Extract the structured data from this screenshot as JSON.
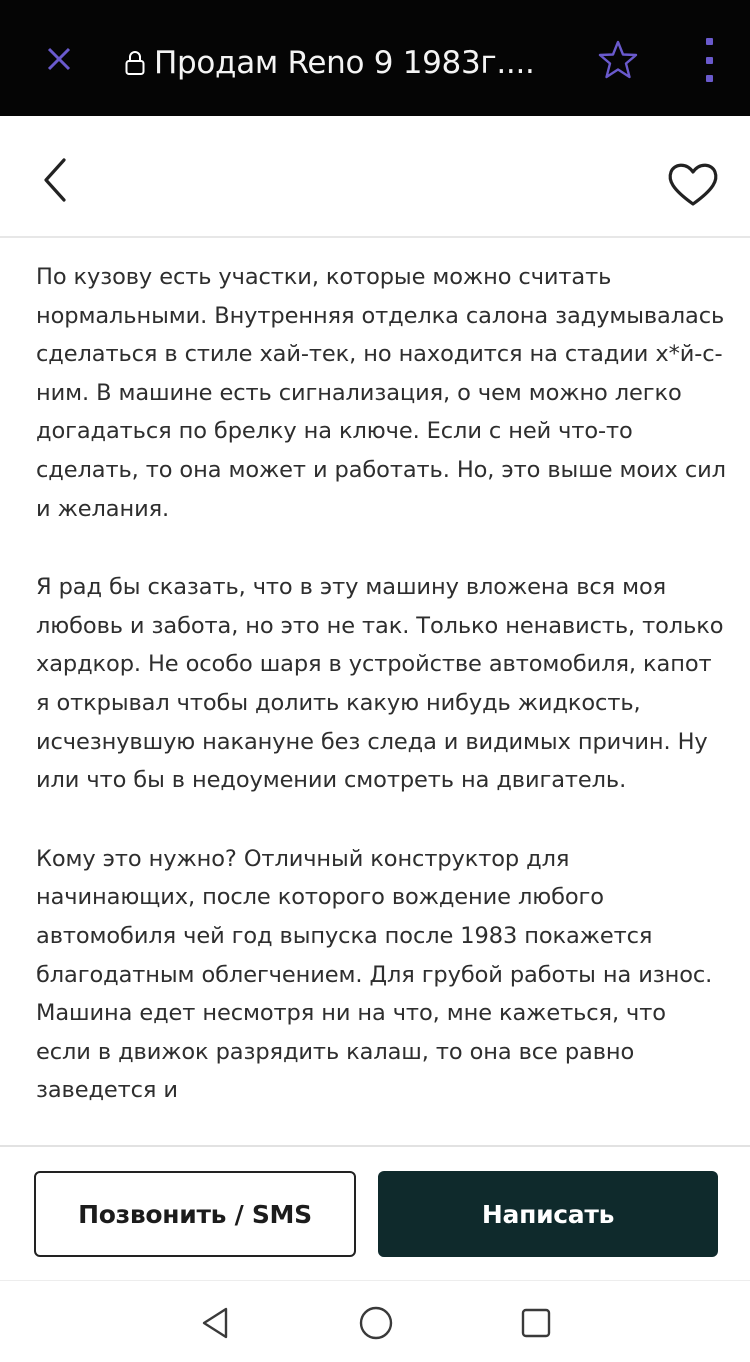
{
  "browser": {
    "title": "Продам Reno 9 1983г....",
    "icons": {
      "close": "close-icon",
      "lock": "lock-icon",
      "star": "star-icon",
      "menu": "more-vertical-icon"
    },
    "colors": {
      "bar": "#050505",
      "close": "#6a5acd",
      "star": "#6a5acd",
      "menu": "#6a5acd"
    }
  },
  "header": {
    "icons": {
      "back": "chevron-left-icon",
      "favorite": "heart-icon"
    }
  },
  "content": {
    "paragraphs": [
      "По кузову есть участки, которые можно считать нормальными. Внутренняя отделка салона задумывалась сделаться в стиле хай-тек, но находится на стадии х*й-с-ним. В машине есть сигнализация, о чем можно легко догадаться по брелку на ключе. Если с ней что-то сделать, то она может и работать. Но, это выше моих сил и желания.",
      "Я рад бы сказать, что в эту машину вложена вся моя любовь и забота, но это не так. Только ненависть, только хардкор. Не особо шаря в устройстве автомобиля, капот я открывал чтобы долить какую нибудь жидкость, исчезнувшую накануне без следа и видимых причин. Ну или что бы в недоумении смотреть на двигатель.",
      "Кому это нужно? Отличный конструктор для начинающих, после которого вождение любого автомобиля чей год выпуска после 1983 покажется благодатным облегчением. Для грубой работы на износ. Машина едет несмотря ни на что, мне кажеться, что если в движок разрядить калаш, то она все равно заведется и"
    ]
  },
  "actions": {
    "call_label": "Позвонить / SMS",
    "write_label": "Написать",
    "colors": {
      "write_bg": "#0f2a2c"
    }
  },
  "system_nav": {
    "icons": {
      "back": "triangle-back-icon",
      "home": "circle-home-icon",
      "recent": "square-recent-icon"
    }
  }
}
